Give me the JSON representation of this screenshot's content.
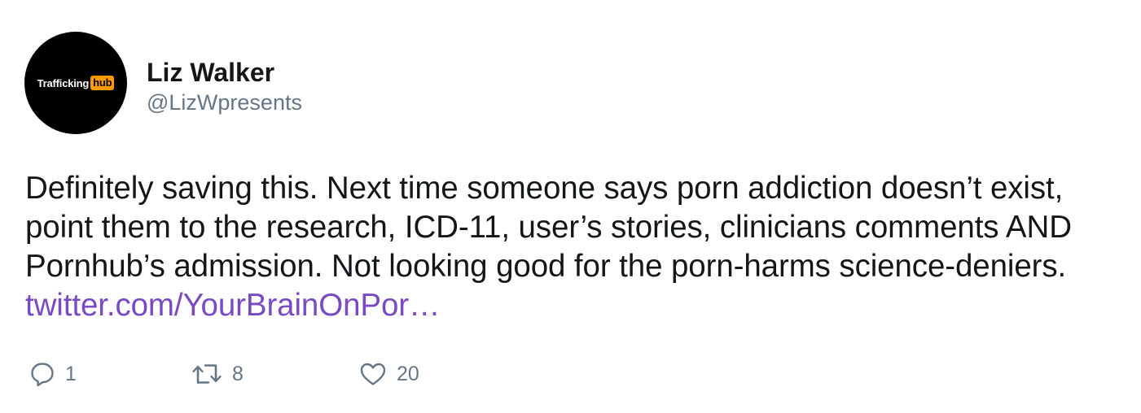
{
  "author": {
    "display_name": "Liz Walker",
    "handle": "@LizWpresents",
    "avatar": {
      "logo_word": "Trafficking",
      "logo_hub": "hub",
      "background_color": "#000000",
      "hub_color": "#ff9900"
    }
  },
  "tweet": {
    "text": "Definitely saving this. Next time someone says porn addiction doesn’t exist, point them to the research, ICD-11, user’s stories, clinicians comments AND Pornhub’s admission. Not looking good for the porn-harms science-deniers. ",
    "link_text": "twitter.com/YourBrainOnPor…",
    "link_color": "#7a49c4"
  },
  "actions": {
    "reply": {
      "icon": "reply-icon",
      "count": "1"
    },
    "retweet": {
      "icon": "retweet-icon",
      "count": "8"
    },
    "like": {
      "icon": "heart-icon",
      "count": "20"
    }
  },
  "colors": {
    "text": "#14171a",
    "secondary": "#657786"
  }
}
